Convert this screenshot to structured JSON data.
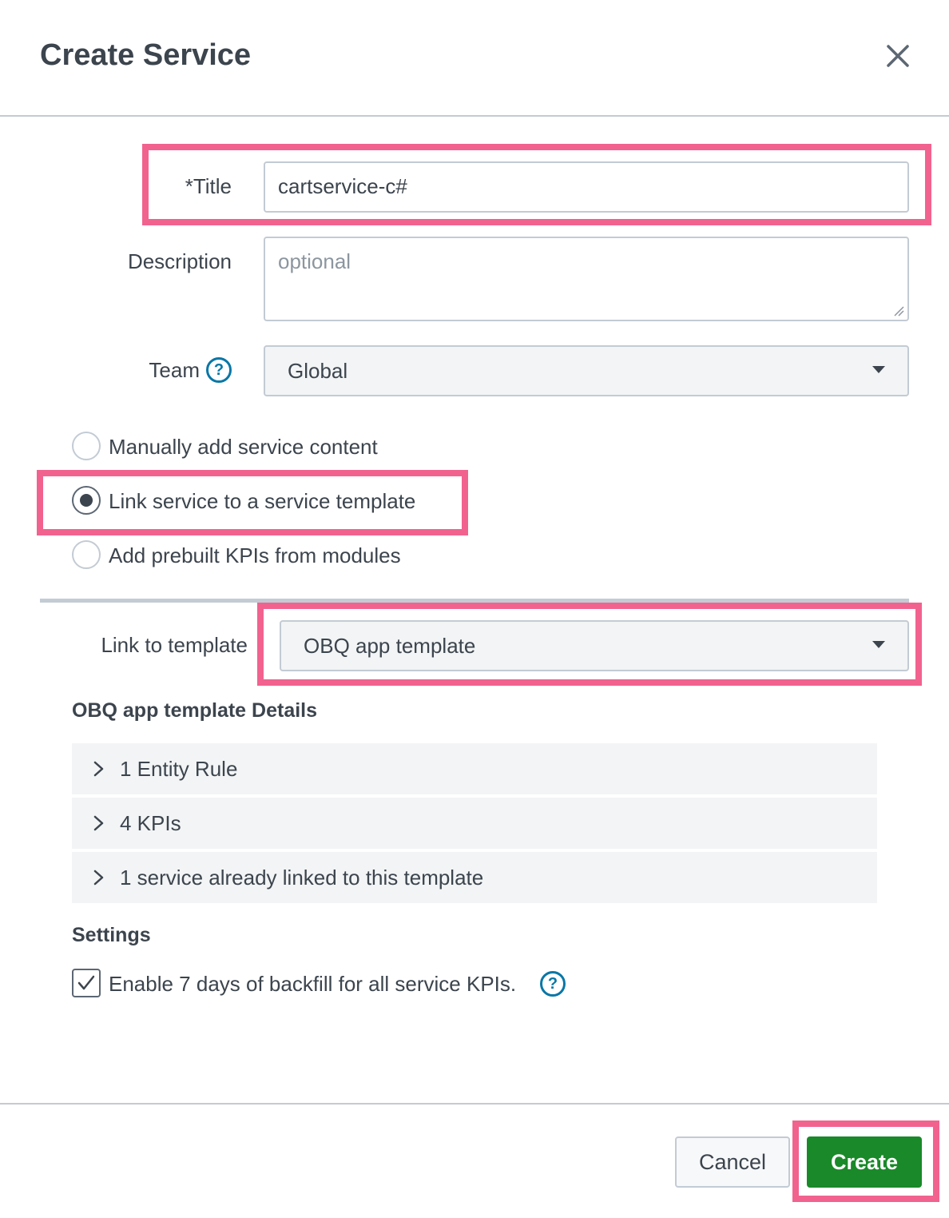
{
  "modal": {
    "title": "Create Service"
  },
  "form": {
    "title_label": "*Title",
    "title_value": "cartservice-c#",
    "description_label": "Description",
    "description_placeholder": "optional",
    "team_label": "Team",
    "team_value": "Global",
    "help_glyph": "?"
  },
  "content_options": [
    {
      "label": "Manually add service content",
      "selected": false
    },
    {
      "label": "Link service to a service template",
      "selected": true
    },
    {
      "label": "Add prebuilt KPIs from modules",
      "selected": false
    }
  ],
  "template": {
    "link_label": "Link to template",
    "selected": "OBQ app template",
    "details_title": "OBQ app template Details",
    "details": [
      {
        "label": "1 Entity Rule"
      },
      {
        "label": "4 KPIs"
      },
      {
        "label": "1 service already linked to this template"
      }
    ]
  },
  "settings": {
    "title": "Settings",
    "backfill_label": "Enable 7 days of backfill for all service KPIs.",
    "backfill_checked": true
  },
  "footer": {
    "cancel_label": "Cancel",
    "create_label": "Create"
  },
  "colors": {
    "highlight": "#f2628f",
    "primary_button": "#1a8929",
    "help_icon": "#0877a6",
    "text": "#3c444d"
  },
  "icons": [
    "close-icon",
    "help-icon",
    "chevron-right-icon",
    "dropdown-caret-icon",
    "checkmark-icon"
  ]
}
